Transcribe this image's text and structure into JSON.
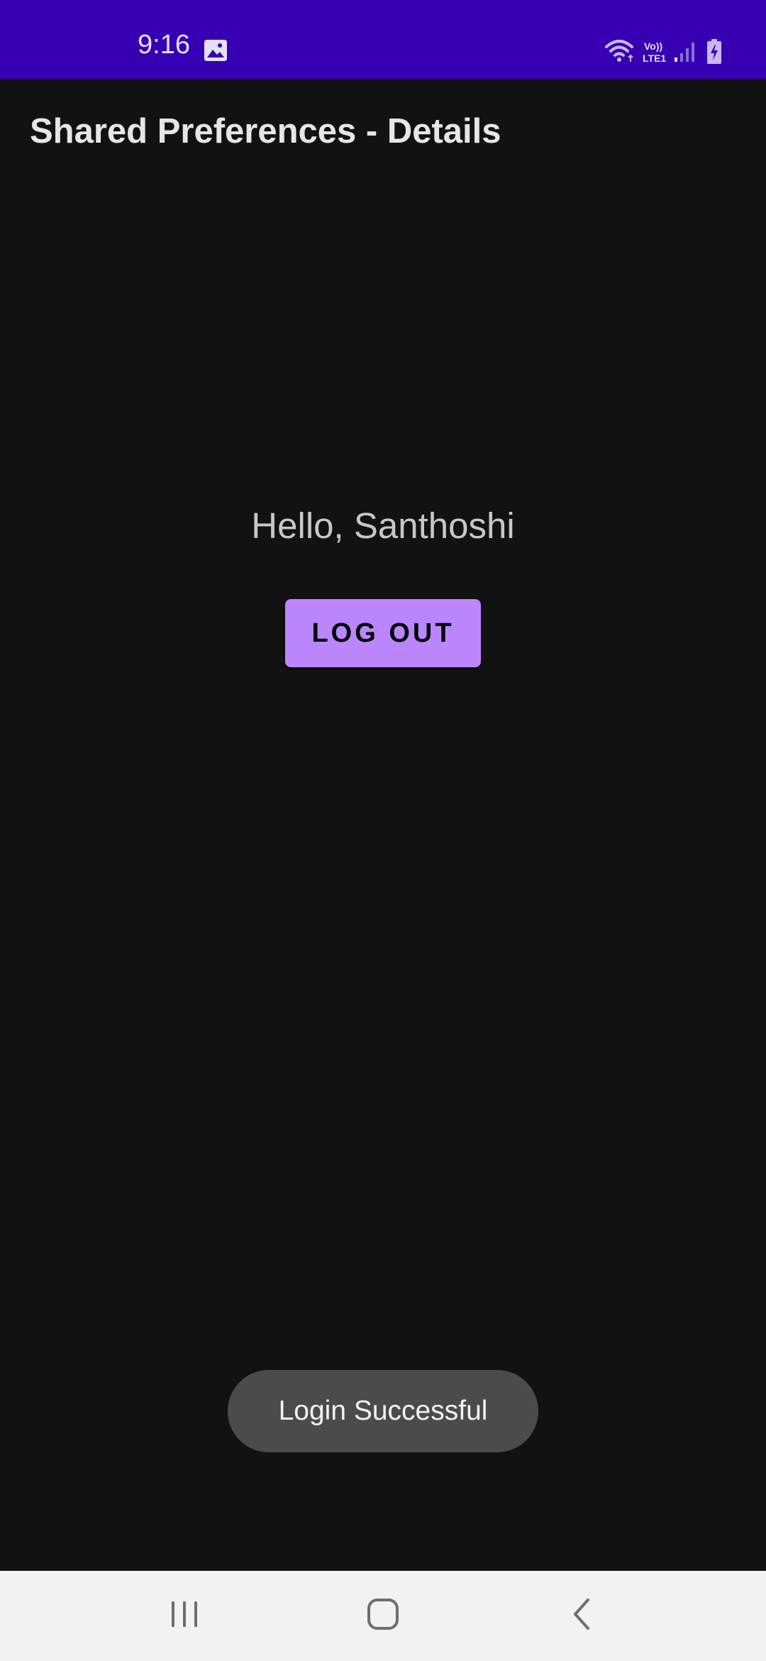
{
  "status_bar": {
    "time": "9:16",
    "volte_label_top": "Vo))",
    "volte_label_bottom": "LTE1",
    "background_color": "#3700b3",
    "icons": [
      "gallery-icon",
      "wifi-icon",
      "volte-icon",
      "signal-icon",
      "battery-charging-icon"
    ]
  },
  "app_bar": {
    "title": "Shared Preferences - Details"
  },
  "main": {
    "greeting": "Hello, Santhoshi",
    "logout_label": "LOG OUT",
    "accent_color": "#bb86fc"
  },
  "toast": {
    "message": "Login Successful"
  },
  "nav_bar": {
    "buttons": [
      "recents-icon",
      "home-icon",
      "back-icon"
    ]
  }
}
